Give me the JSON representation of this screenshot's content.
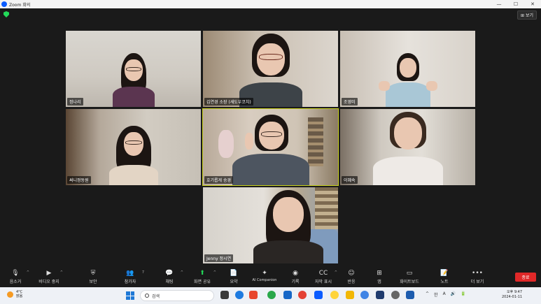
{
  "window": {
    "title": "Zoom 회의",
    "controls": [
      "—",
      "☐",
      "✕"
    ]
  },
  "meeting": {
    "view_button": "보기",
    "participants": [
      {
        "name": "정나리"
      },
      {
        "name": "김연경 소장 (섀도우코치)"
      },
      {
        "name": "조영미"
      },
      {
        "name": "써니정동원"
      },
      {
        "name": "호기롭게 송경"
      },
      {
        "name": "이혜숙"
      },
      {
        "name": "Jenny 정시연"
      }
    ]
  },
  "toolbar": {
    "items": [
      {
        "label": "음소거",
        "icon": "mic-icon"
      },
      {
        "label": "비디오 중지",
        "icon": "video-icon"
      },
      {
        "label": "보안",
        "icon": "shield-icon"
      },
      {
        "label": "참가자",
        "icon": "participants-icon",
        "count": "7"
      },
      {
        "label": "채팅",
        "icon": "chat-icon"
      },
      {
        "label": "화면 공유",
        "icon": "share-screen-icon"
      },
      {
        "label": "요약",
        "icon": "summary-icon"
      },
      {
        "label": "AI Companion",
        "icon": "sparkle-icon"
      },
      {
        "label": "기록",
        "icon": "record-icon"
      },
      {
        "label": "자막 표시",
        "icon": "cc-icon"
      },
      {
        "label": "반응",
        "icon": "reaction-icon"
      },
      {
        "label": "앱",
        "icon": "apps-icon"
      },
      {
        "label": "화이트보드",
        "icon": "whiteboard-icon"
      },
      {
        "label": "노트",
        "icon": "notes-icon"
      },
      {
        "label": "더 보기",
        "icon": "more-icon"
      }
    ],
    "end_label": "종료"
  },
  "taskbar": {
    "weather": {
      "temp": "4°C",
      "desc": "맑음"
    },
    "search_placeholder": "검색",
    "tray": [
      "^",
      "한",
      "A",
      "🔊",
      "🔋"
    ],
    "clock": {
      "time": "오후 9:47",
      "date": "2024-01-11"
    }
  },
  "colors": {
    "active_speaker": "#c9d21c",
    "end_button": "#e02828",
    "accent": "#0b5cff"
  }
}
